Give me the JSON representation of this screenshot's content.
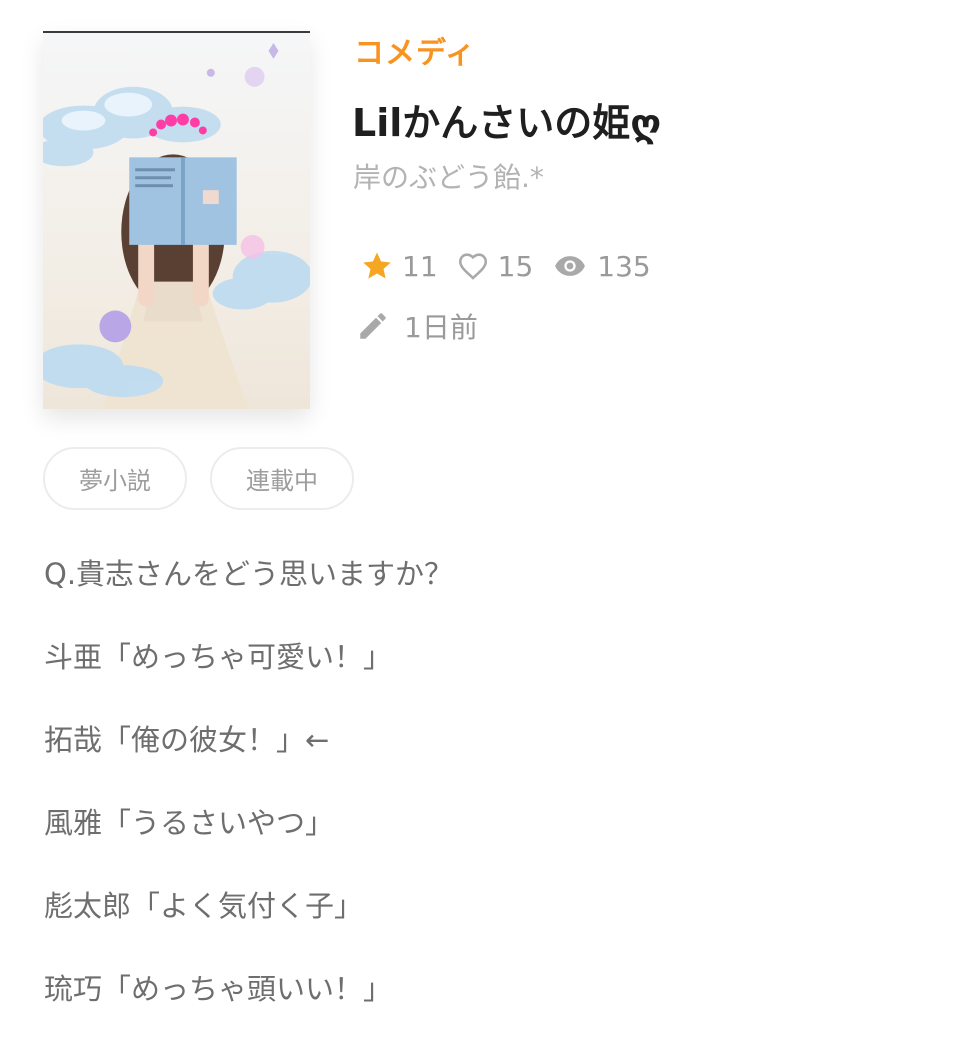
{
  "cover": {
    "alt": "novel cover",
    "icon": "book-cover-image"
  },
  "genre": "コメディ",
  "title": "Lilかんさいの姫ღ",
  "author": "岸のぶどう飴.*",
  "stats": {
    "stars": "11",
    "likes": "15",
    "views": "135"
  },
  "updated": "1日前",
  "tags": [
    {
      "label": "夢小説"
    },
    {
      "label": "連載中"
    }
  ],
  "description_lines": [
    "Q.貴志さんをどう思いますか？",
    "斗亜「めっちゃ可愛い！」",
    "拓哉「俺の彼女！」←",
    "風雅「うるさいやつ」",
    "彪太郎「よく気付く子」",
    "琉巧「めっちゃ頭いい！」"
  ],
  "colors": {
    "accent": "#f7931e",
    "star": "#f5a623",
    "meta": "#9a9a9a"
  }
}
